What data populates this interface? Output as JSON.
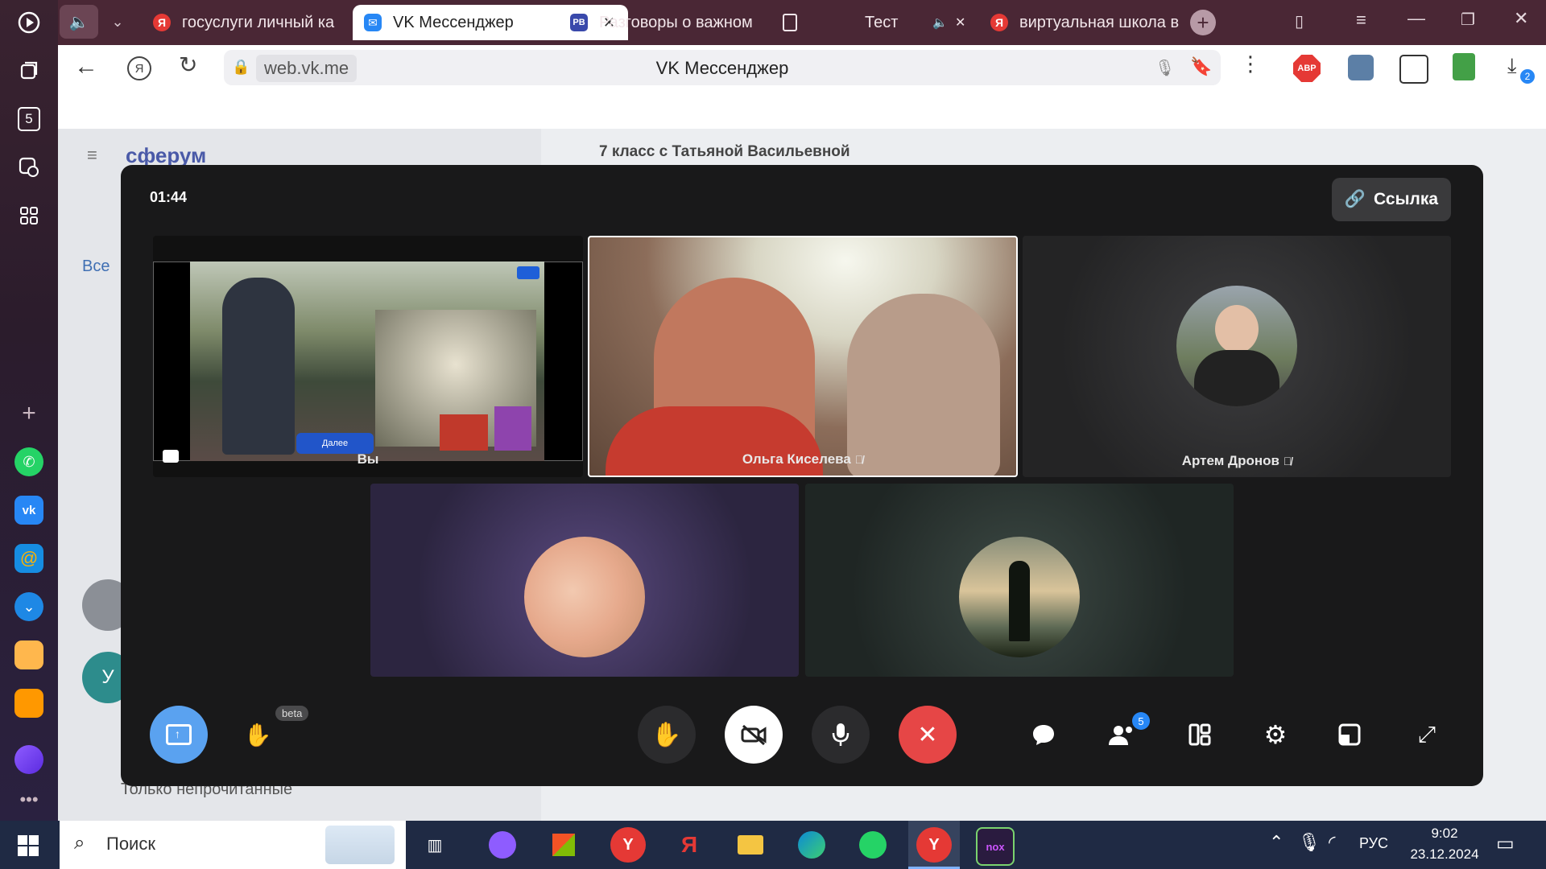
{
  "browser": {
    "tabs": [
      {
        "label": "госуслуги личный ка",
        "favicon": "Я",
        "color": "#e53935"
      },
      {
        "label": "VK Мессенджер",
        "favicon": "vk",
        "color": "#2787f5",
        "active": true
      },
      {
        "label": "Разговоры о важном",
        "favicon": "РВ",
        "color": "#3949ab"
      },
      {
        "label": "Тест",
        "favicon": "doc"
      },
      {
        "label": "виртуальная школа в",
        "favicon": "Я",
        "color": "#e53935"
      }
    ],
    "url_domain": "web.vk.me",
    "page_title": "VK Мессенджер",
    "abp_label": "ABP",
    "downloads_badge": "2",
    "sidebar_badge": "5"
  },
  "vk": {
    "logo": "сферум",
    "chat_title": "7 класс с Татьяной Васильевной",
    "filter_all": "Все",
    "unread_only": "Только непрочитанные",
    "avatar_letter": "У"
  },
  "call": {
    "timer": "01:44",
    "link_button": "Ссылка",
    "participants": [
      {
        "name": "Вы"
      },
      {
        "name": "Ольга Киселева",
        "muted": true
      },
      {
        "name": "Артем Дронов",
        "muted": true
      }
    ],
    "slide_button": "Далее",
    "beta_label": "beta",
    "participants_badge": "5"
  },
  "taskbar": {
    "search_placeholder": "Поиск",
    "lang": "РУС",
    "time": "9:02",
    "date": "23.12.2024"
  },
  "colors": {
    "accent": "#2787f5",
    "hangup": "#e64646",
    "tabbar": "#4a2735"
  }
}
